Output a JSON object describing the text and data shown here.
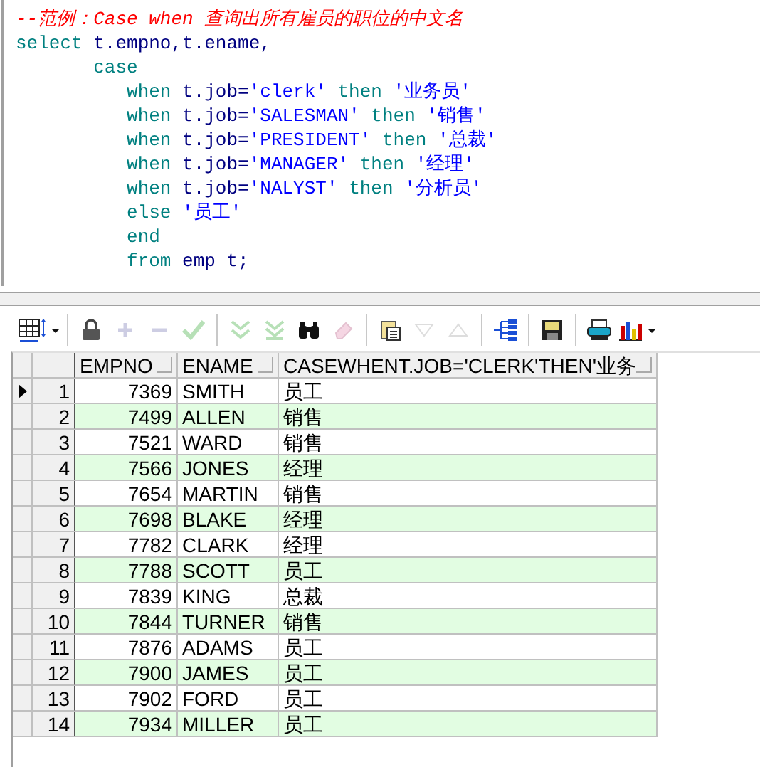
{
  "editor": {
    "lines": [
      [
        {
          "kind": "comment",
          "text": "--范例：Case when 查询出所有雇员的职位的中文名"
        }
      ],
      [
        {
          "kind": "keyword",
          "text": "select "
        },
        {
          "kind": "ident",
          "text": "t.empno,t.ename,"
        }
      ],
      [
        {
          "kind": "keyword",
          "text": "       case"
        }
      ],
      [
        {
          "kind": "keyword",
          "text": "          when "
        },
        {
          "kind": "ident",
          "text": "t.job="
        },
        {
          "kind": "string",
          "text": "'clerk'"
        },
        {
          "kind": "keyword",
          "text": " then "
        },
        {
          "kind": "string",
          "text": "'业务员'"
        }
      ],
      [
        {
          "kind": "keyword",
          "text": "          when "
        },
        {
          "kind": "ident",
          "text": "t.job="
        },
        {
          "kind": "string",
          "text": "'SALESMAN'"
        },
        {
          "kind": "keyword",
          "text": " then "
        },
        {
          "kind": "string",
          "text": "'销售'"
        }
      ],
      [
        {
          "kind": "keyword",
          "text": "          when "
        },
        {
          "kind": "ident",
          "text": "t.job="
        },
        {
          "kind": "string",
          "text": "'PRESIDENT'"
        },
        {
          "kind": "keyword",
          "text": " then "
        },
        {
          "kind": "string",
          "text": "'总裁'"
        }
      ],
      [
        {
          "kind": "keyword",
          "text": "          when "
        },
        {
          "kind": "ident",
          "text": "t.job="
        },
        {
          "kind": "string",
          "text": "'MANAGER'"
        },
        {
          "kind": "keyword",
          "text": " then "
        },
        {
          "kind": "string",
          "text": "'经理'"
        }
      ],
      [
        {
          "kind": "keyword",
          "text": "          when "
        },
        {
          "kind": "ident",
          "text": "t.job="
        },
        {
          "kind": "string",
          "text": "'NALYST'"
        },
        {
          "kind": "keyword",
          "text": " then "
        },
        {
          "kind": "string",
          "text": "'分析员'"
        }
      ],
      [
        {
          "kind": "keyword",
          "text": "          else "
        },
        {
          "kind": "string",
          "text": "'员工'"
        }
      ],
      [
        {
          "kind": "keyword",
          "text": "          end"
        }
      ],
      [
        {
          "kind": "keyword",
          "text": "          from "
        },
        {
          "kind": "ident",
          "text": "emp t;"
        }
      ]
    ]
  },
  "toolbar": [
    {
      "kind": "grid",
      "disabled": false
    },
    {
      "kind": "sep"
    },
    {
      "kind": "lock",
      "disabled": false
    },
    {
      "kind": "plus",
      "disabled": true
    },
    {
      "kind": "minus",
      "disabled": true
    },
    {
      "kind": "check",
      "disabled": true
    },
    {
      "kind": "sep"
    },
    {
      "kind": "next",
      "disabled": true
    },
    {
      "kind": "last",
      "disabled": true
    },
    {
      "kind": "find",
      "disabled": false
    },
    {
      "kind": "eraser",
      "disabled": true
    },
    {
      "kind": "sep"
    },
    {
      "kind": "clip",
      "disabled": false
    },
    {
      "kind": "down",
      "disabled": true
    },
    {
      "kind": "up",
      "disabled": true
    },
    {
      "kind": "sep"
    },
    {
      "kind": "tree",
      "disabled": false
    },
    {
      "kind": "sep"
    },
    {
      "kind": "save",
      "disabled": false
    },
    {
      "kind": "sep"
    },
    {
      "kind": "print",
      "disabled": false
    },
    {
      "kind": "chart",
      "disabled": false
    }
  ],
  "table": {
    "columns": [
      "EMPNO",
      "ENAME",
      "CASEWHENT.JOB='CLERK'THEN'业务"
    ],
    "rows": [
      {
        "num": "1",
        "current": true,
        "cells": [
          "7369",
          "SMITH",
          "员工"
        ]
      },
      {
        "num": "2",
        "current": false,
        "cells": [
          "7499",
          "ALLEN",
          "销售"
        ]
      },
      {
        "num": "3",
        "current": false,
        "cells": [
          "7521",
          "WARD",
          "销售"
        ]
      },
      {
        "num": "4",
        "current": false,
        "cells": [
          "7566",
          "JONES",
          "经理"
        ]
      },
      {
        "num": "5",
        "current": false,
        "cells": [
          "7654",
          "MARTIN",
          "销售"
        ]
      },
      {
        "num": "6",
        "current": false,
        "cells": [
          "7698",
          "BLAKE",
          "经理"
        ]
      },
      {
        "num": "7",
        "current": false,
        "cells": [
          "7782",
          "CLARK",
          "经理"
        ]
      },
      {
        "num": "8",
        "current": false,
        "cells": [
          "7788",
          "SCOTT",
          "员工"
        ]
      },
      {
        "num": "9",
        "current": false,
        "cells": [
          "7839",
          "KING",
          "总裁"
        ]
      },
      {
        "num": "10",
        "current": false,
        "cells": [
          "7844",
          "TURNER",
          "销售"
        ]
      },
      {
        "num": "11",
        "current": false,
        "cells": [
          "7876",
          "ADAMS",
          "员工"
        ]
      },
      {
        "num": "12",
        "current": false,
        "cells": [
          "7900",
          "JAMES",
          "员工"
        ]
      },
      {
        "num": "13",
        "current": false,
        "cells": [
          "7902",
          "FORD",
          "员工"
        ]
      },
      {
        "num": "14",
        "current": false,
        "cells": [
          "7934",
          "MILLER",
          "员工"
        ]
      }
    ]
  }
}
